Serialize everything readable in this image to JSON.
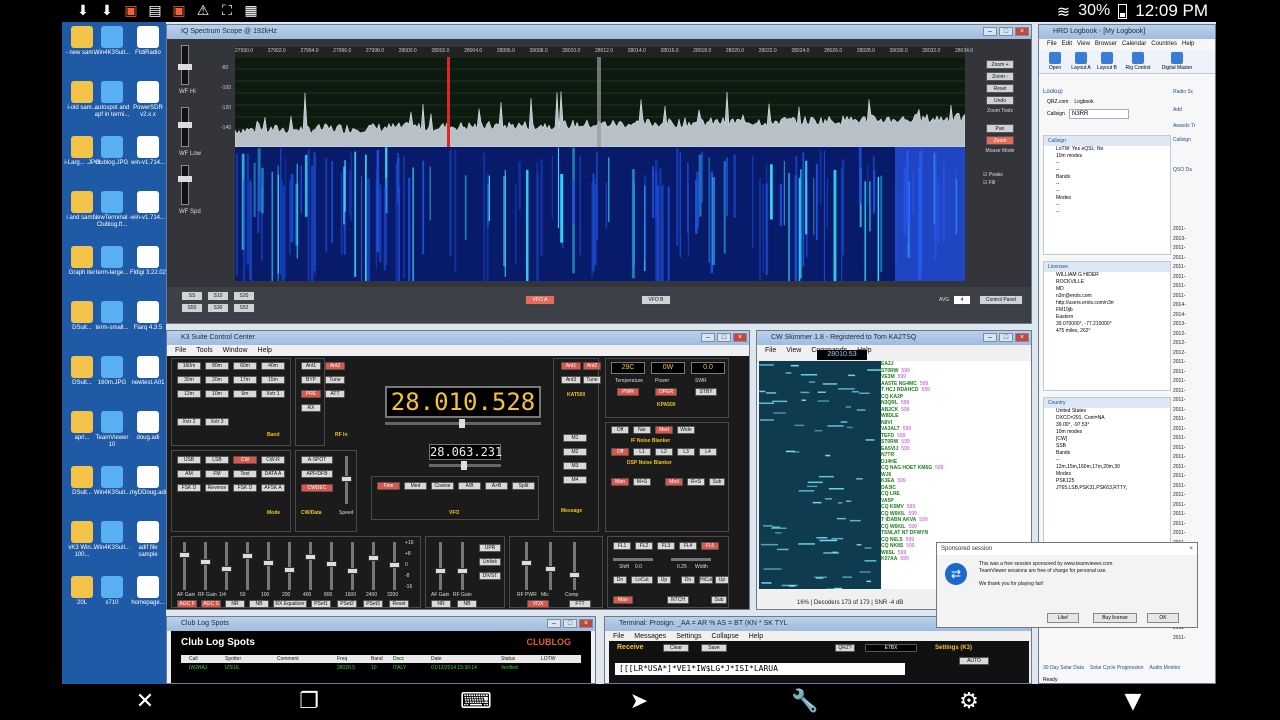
{
  "statusbar": {
    "icons": [
      "download-icon",
      "download-icon",
      "screenshot-icon",
      "gallery-icon",
      "screenshot-icon",
      "warning-icon",
      "crop-icon",
      "clipboard-icon"
    ],
    "battery": "30%",
    "time": "12:09 PM"
  },
  "desktop_icons": [
    {
      "label": "- new sam...",
      "col": 0
    },
    {
      "label": "Win4K3Suit...",
      "col": 1
    },
    {
      "label": "FtdiRadio",
      "col": 2
    },
    {
      "label": "i-old sam...",
      "col": 0
    },
    {
      "label": "autospot and apf in termi...",
      "col": 1
    },
    {
      "label": "PowerSDR v2.x.x",
      "col": 2
    },
    {
      "label": "i-Larg... .JPG",
      "col": 0
    },
    {
      "label": "clublog.JPG",
      "col": 1
    },
    {
      "label": "win-v1.714...",
      "col": 2
    },
    {
      "label": "i and sam...",
      "col": 0
    },
    {
      "label": "NewTerminal - Clublog.ft...",
      "col": 1
    },
    {
      "label": "win-v1.714...",
      "col": 2
    },
    {
      "label": "Graph iter",
      "col": 0
    },
    {
      "label": "term-large...",
      "col": 1
    },
    {
      "label": "Fldigi 3.22.02",
      "col": 2
    },
    {
      "label": "DSuit...",
      "col": 0
    },
    {
      "label": "term-small...",
      "col": 1
    },
    {
      "label": "Flarq 4.3.5",
      "col": 2
    },
    {
      "label": "DSuit...",
      "col": 0
    },
    {
      "label": "160m.JPG",
      "col": 1
    },
    {
      "label": "newtest.A01",
      "col": 2
    },
    {
      "label": "aprl...",
      "col": 0
    },
    {
      "label": "TeamViewer 10",
      "col": 1
    },
    {
      "label": "doug.adi",
      "col": 2
    },
    {
      "label": "DSuit...",
      "col": 0
    },
    {
      "label": "Win4K3Suit...",
      "col": 1
    },
    {
      "label": "myDDoug.adi",
      "col": 2
    },
    {
      "label": "vK3 Win... 100...",
      "col": 0
    },
    {
      "label": "Win4K3Suit...",
      "col": 1
    },
    {
      "label": "adif file sample",
      "col": 2
    },
    {
      "label": "20L",
      "col": 0
    },
    {
      "label": "x710",
      "col": 1
    },
    {
      "label": "homepage...",
      "col": 2
    }
  ],
  "spectrum": {
    "title": "IQ Spectrum Scope @ 192kHz",
    "freq_ticks": [
      "27990.0",
      "27992.0",
      "27994.0",
      "27996.0",
      "27998.0",
      "28000.0",
      "28002.0",
      "28004.0",
      "28006.0",
      "28008.0",
      "28010.0",
      "28012.0",
      "28014.0",
      "28016.0",
      "28018.0",
      "28020.0",
      "28022.0",
      "28024.0",
      "28026.0",
      "28028.0",
      "28030.0",
      "28032.0",
      "28034.0"
    ],
    "db_ticks": [
      "-80",
      "-100",
      "-120",
      "-140"
    ],
    "left_labels": [
      "WF Hi",
      "WF Low",
      "WF Spd"
    ],
    "right_buttons": [
      "Zoom +",
      "Zoom -",
      "Reset",
      "Undo"
    ],
    "zoom_tools": "Zoom Tools",
    "pan_buttons": [
      "Pan",
      "Zoom"
    ],
    "mouse_mode": "Mouse Mode",
    "checks": [
      "Peaks",
      "Fill"
    ],
    "bottom_left": [
      "SS",
      "S10",
      "S20",
      "S50",
      "S30",
      "S52"
    ],
    "vfoa": "VFO A",
    "vfob": "VFO B",
    "avg_label": "AVG",
    "avg_value": "4",
    "control_panel": "Control Panel"
  },
  "k3": {
    "title": "K3 Suite Control Center",
    "menu": [
      "File",
      "Tools",
      "Window",
      "Help"
    ],
    "freq_a": "28.010.528",
    "freq_b": "28.063.231",
    "band_buttons": [
      "160m",
      "80m",
      "60m",
      "40m",
      "30m",
      "20m",
      "17m",
      "15m",
      "12m",
      "10m",
      "6m",
      "Xvtr 1",
      "Xvtr 2",
      "Xvtr 3"
    ],
    "band_label": "Band",
    "rf_buttons": [
      "Ant1",
      "Ant2",
      "BYP",
      "Tune",
      "PRE",
      "ATT",
      "RX"
    ],
    "rf_label": "RF In",
    "ant_right": [
      "Ant1",
      "Ant2",
      "Ant3",
      "Tune"
    ],
    "kat_label": "KAT500",
    "lcd_vals": [
      "29C",
      "0W",
      "0.0"
    ],
    "lcd_labels": [
      "Temperature",
      "Power",
      "SWR"
    ],
    "kpa_btns": [
      "PWR",
      "OPER",
      "STBY"
    ],
    "kpa_label": "KPA500",
    "mode_buttons": [
      "USB",
      "LSB",
      "CW",
      "CW-R",
      "AM",
      "FM",
      "Text",
      "DATA A",
      "FSK D",
      "Reverse",
      "FSK D",
      "AFSK A"
    ],
    "mode_label": "Mode",
    "cw_buttons": [
      "A-SPOT",
      "APF/DFB",
      "CWDEC"
    ],
    "cw_label": "CW/Data",
    "speed_label": "Speed",
    "vfo_buttons": [
      "Fine",
      "Med",
      "Coarse",
      "A/B",
      "A>B",
      "Split"
    ],
    "vfo_label": "VFO",
    "msg_buttons": [
      "M1",
      "M2",
      "M3",
      "M4"
    ],
    "msg_label": "Message",
    "nb_buttons": [
      "Off",
      "Nar",
      "Med",
      "Wide"
    ],
    "nb_label": "IF Noise Blanker",
    "dsp_buttons": [
      "Off",
      "L1",
      "L2",
      "L3",
      "L4"
    ],
    "dsp_label": "DSP Noise Blanker",
    "nr_buttons": [
      "Man",
      "M+S",
      "Med",
      "R+S",
      "Sub"
    ],
    "main_sliders": [
      "AF Gain",
      "RF Gain",
      "1/4",
      "50",
      "100",
      "200",
      "400",
      "800",
      "1600",
      "2400",
      "3200"
    ],
    "main_buttons": [
      "AGC F",
      "AGC S",
      "NR",
      "NB",
      "RX Equalizer",
      "PSet1",
      "PSet2",
      "PSet3",
      "Reset"
    ],
    "main_label": "Main Receiver",
    "db_labels": [
      "+16",
      "+8",
      "0",
      "-8",
      "-16"
    ],
    "sub_sliders": [
      "AF Gain",
      "RF Gain"
    ],
    "sub_buttons": [
      "NR",
      "NB",
      "UPR",
      "Unlink",
      "DIVST"
    ],
    "sub_label": "Sub Receiver",
    "tx_sliders": [
      "RF PWR",
      "Mic",
      "Comp"
    ],
    "tx_buttons": [
      "VOX",
      "FTT"
    ],
    "tx_label": "Transmit",
    "filter_buttons": [
      "FL1",
      "FL2",
      "FL3",
      "FL4",
      "FL5",
      "Dn",
      "LoCut",
      "Up",
      "Dn",
      "HiCut",
      "Up",
      "Man",
      "NTCH",
      "Sub"
    ],
    "shift_label": "Shift",
    "shift_val": "0.0",
    "width_label": "Width",
    "width_val": "0.25",
    "filter_label": "Filter"
  },
  "cw": {
    "title": "CW Skimmer 1.8 - Registered to Tom KA2TSQ",
    "menu": [
      "File",
      "View",
      "Commands",
      "Help"
    ],
    "freq": "28010.53",
    "spots": [
      {
        "call": "EA2J",
        "extra": ""
      },
      {
        "call": "ST0RW",
        "extra": "599"
      },
      {
        "call": "VE3M",
        "extra": "599"
      },
      {
        "call": "AA5TE NG4MC",
        "extra": "599"
      },
      {
        "call": "T HCJ RDAHCD",
        "extra": "599"
      },
      {
        "call": "CQ KA2P",
        "extra": ""
      },
      {
        "call": "N3QRL",
        "extra": "599"
      },
      {
        "call": "AB2CK",
        "extra": "599"
      },
      {
        "call": "W8DLE",
        "extra": ""
      },
      {
        "call": "N8VI",
        "extra": ""
      },
      {
        "call": "VA3ALT",
        "extra": "599"
      },
      {
        "call": "TEFD",
        "extra": "599"
      },
      {
        "call": "ST0RW",
        "extra": "599"
      },
      {
        "call": "EA5VIJ",
        "extra": "599"
      },
      {
        "call": "N7TR",
        "extra": ""
      },
      {
        "call": "DJ4HE",
        "extra": ""
      },
      {
        "call": "CQ NAG HOET KM6G",
        "extra": "599"
      },
      {
        "call": "WJ6",
        "extra": ""
      },
      {
        "call": "K3EA",
        "extra": "599"
      },
      {
        "call": "DA3IC",
        "extra": ""
      },
      {
        "call": "CQ LRE",
        "extra": ""
      },
      {
        "call": "VA5P",
        "extra": ""
      },
      {
        "call": "CQ K5MV",
        "extra": "599"
      },
      {
        "call": "CQ W6KIL",
        "extra": "599"
      },
      {
        "call": "T IDABN AKVA",
        "extra": "599"
      },
      {
        "call": "CQ W6KIL",
        "extra": "599"
      },
      {
        "call": "TSNLAT NT DFWYN",
        "extra": ""
      },
      {
        "call": "CQ N6LS",
        "extra": "599"
      },
      {
        "call": "CQ NK8S",
        "extra": "599"
      },
      {
        "call": "W6SL",
        "extra": "599"
      },
      {
        "call": "K07AA",
        "extra": "599"
      }
    ],
    "status_percent": "16%",
    "status_decoders": "Decoders 173 of 173",
    "status_snr": "SNR -4 dB"
  },
  "hrd": {
    "title": "HRD Logbook - [My Logbook]",
    "menu": [
      "File",
      "Edit",
      "View",
      "Browser",
      "Calendar",
      "Countries",
      "Help"
    ],
    "ribbon": [
      "Open",
      "Layout A",
      "Layout B",
      "Rig Control",
      "Digital Master"
    ],
    "lookup_title": "Lookup",
    "lookup_tabs": [
      "QRZ.com",
      "Logbook"
    ],
    "callsign_label": "Callsign",
    "callsign_value": "N3RR",
    "callsign_panel": {
      "title": "Callsign",
      "rows": [
        "LoTW: Yes eQSL: No",
        "10m modes",
        "--",
        "--",
        "Bands",
        "--",
        "--",
        "Modes",
        "--",
        "--"
      ]
    },
    "licensee_panel": {
      "title": "Licensee",
      "rows": [
        "WILLIAM G HIDER",
        "ROCKVILLE",
        "MD",
        "n3rr@erols.com",
        "http://users.erols.com/n3rr",
        "FM19jb",
        "Eastern",
        "39.070000°, -77.210000°",
        "475 miles, 262°"
      ]
    },
    "country_panel": {
      "title": "Country",
      "rows": [
        "United States",
        "DXCC=291, Cont=NA",
        "39.00°, -97.53°",
        "10m modes",
        "[CW]",
        "SSB",
        "Bands",
        "--",
        "12m,15m,160m,17m,20m,30",
        "Modes",
        "PSK125",
        "JT65,LSB,PSK31,PSK63,RTTY,"
      ]
    },
    "log_dates": [
      "2011-",
      "2013-",
      "2011-",
      "2011-",
      "2011-",
      "2011-",
      "2011-",
      "2011-",
      "2014-",
      "2014-",
      "2013-",
      "2012-",
      "2012-",
      "2012-",
      "2011-",
      "2011-",
      "2011-",
      "2011-",
      "2011-",
      "2011-",
      "2011-",
      "2011-",
      "2011-",
      "2011-",
      "2011-",
      "2011-",
      "2011-",
      "2011-",
      "2011-",
      "2011-",
      "2011-",
      "2011-",
      "2011-",
      "2011-",
      "2011-",
      "2011-",
      "2011-",
      "2011-",
      "2011-",
      "2011-",
      "2011-",
      "2011-",
      "2011-",
      "2011-"
    ],
    "right_tabs": [
      "Radio Sc",
      "Add",
      "Callsign",
      "Awards Tr",
      "QSO Da"
    ],
    "bottom_tabs": [
      "30 Day Solar Data",
      "Solar Cycle Progression",
      "Audio Monitor"
    ],
    "status": "Ready"
  },
  "clublog": {
    "win_title": "Club Log Spots",
    "title": "Club Log Spots",
    "logo": "CLUBLOG",
    "headers": [
      "Call",
      "Spotter",
      "Comment",
      "Freq",
      "Band",
      "Dxcc",
      "Date",
      "Status",
      "LOTW"
    ],
    "row": [
      "IW2HAJ",
      "IZ5IUL",
      "",
      "28020.5",
      "10",
      "ITALY",
      "01/12/2014 15:30:14",
      "Verified",
      ""
    ]
  },
  "terminal": {
    "title": "Terminal: Prosign: _AA = AR % AS = BT (KN * SK TYL",
    "menu": [
      "File",
      "Messages",
      "Settings",
      "Collapse",
      "Help"
    ],
    "receive": "Receive",
    "clear": "Clear",
    "save": "Save",
    "qrz": "QRZ?",
    "field": "E7BX",
    "settings": "Settings (K3)",
    "auto": "AUTO",
    "text": "[[[LR*USA*]*VE1*IW$LG*J*ISI*LARUA"
  },
  "sponsor": {
    "title": "Sponsored session",
    "line1": "This was a free session sponsored by www.teamviewer.com.",
    "line2": "TeamViewer sessions are free of charge for personal use.",
    "line3": "We thank you for playing fair!",
    "buttons": [
      "Like!",
      "Buy license",
      "OK"
    ]
  },
  "navbar": {
    "icons": [
      "close-icon",
      "windows-icon",
      "keyboard-icon",
      "pointer-icon",
      "wrench-icon",
      "settings-icon",
      "menu-down-icon"
    ]
  },
  "colors": {
    "accent": "#f5c531",
    "waterfall": "#081a6a",
    "spot_call": "#1a7f1a",
    "spot_report": "#c23bd0",
    "clublog_text": "#3bd23b"
  }
}
